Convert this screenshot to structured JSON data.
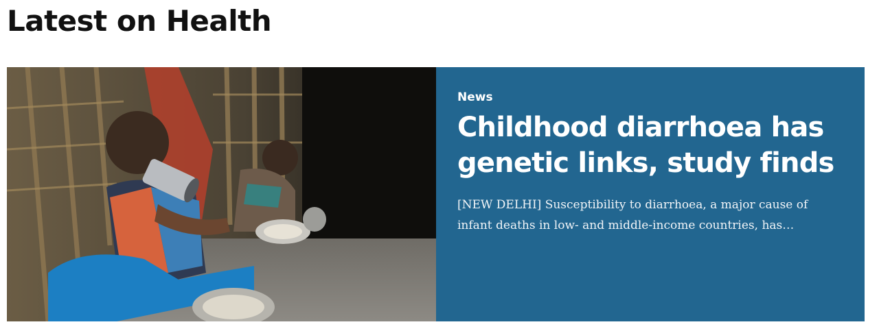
{
  "section": {
    "title": "Latest on Health"
  },
  "article": {
    "category": "News",
    "headline": "Childhood diarrhoea has genetic links, study finds",
    "excerpt": "[NEW DELHI] Susceptibility to diarrhoea, a major cause of infant deaths in low- and middle-income countries, has…",
    "image_subject": "children-eating-meal-on-floor-photo",
    "panel_color": "#226690"
  }
}
